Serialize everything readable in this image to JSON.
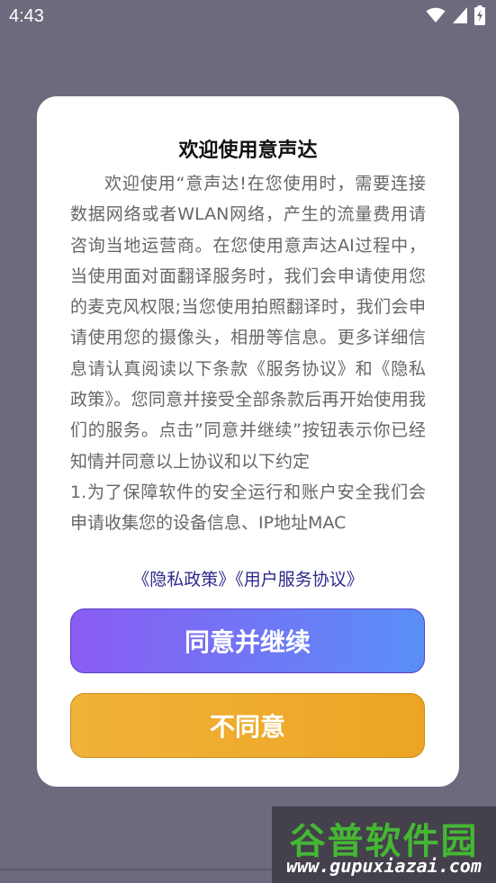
{
  "status_bar": {
    "time": "4:43",
    "icons": [
      "wifi-icon",
      "signal-icon",
      "battery-charging-icon"
    ]
  },
  "dialog": {
    "title": "欢迎使用意声达",
    "body": "欢迎使用“意声达!在您使用时，需要连接数据网络或者WLAN网络，产生的流量费用请咨询当地运营商。在您使用意声达AI过程中，当使用面对面翻译服务时，我们会申请使用您的麦克风权限;当您使用拍照翻译时，我们会申请使用您的摄像头，相册等信息。更多详细信息请认真阅读以下条款《服务协议》和《隐私政策》。您同意并接受全部条款后再开始使用我们的服务。点击”同意并继续”按钮表示你已经知情并同意以上协议和以下约定\n1.为了保障软件的安全运行和账户安全我们会申请收集您的设备信息、IP地址MAC",
    "privacy_link": "《隐私政策》",
    "service_link": "《用户服务协议》",
    "agree_label": "同意并继续",
    "disagree_label": "不同意"
  },
  "watermark": {
    "logo_text": "谷普软件园",
    "url": "www.gupuxiazai.com"
  },
  "colors": {
    "overlay": "#6d6a7e",
    "link": "#2e2a8c",
    "agree_start": "#8a5cf2",
    "agree_end": "#5a8ff7",
    "disagree": "#eca523"
  }
}
